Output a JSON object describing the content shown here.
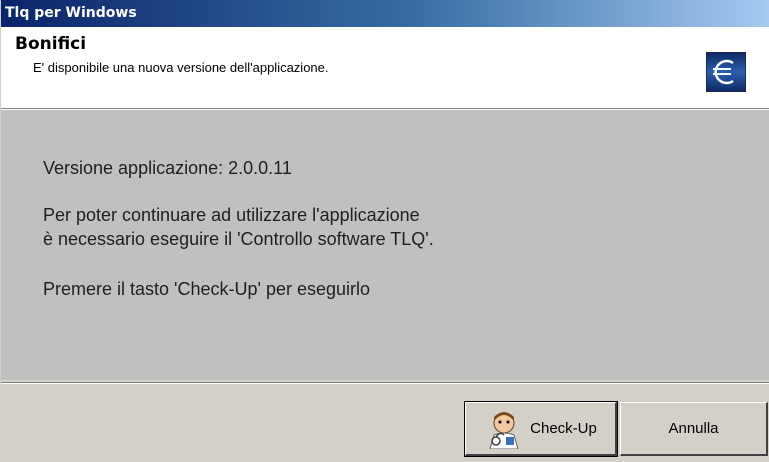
{
  "window": {
    "title": "Tlq per Windows"
  },
  "header": {
    "title": "Bonifici",
    "subtitle": "E' disponibile una nuova versione dell'applicazione.",
    "icon": "euro-icon"
  },
  "message": {
    "version_line": "Versione applicazione: 2.0.0.11",
    "line1": "Per poter continuare ad utilizzare l'applicazione",
    "line2": "è necessario eseguire il 'Controllo software TLQ'.",
    "line3": "Premere il tasto 'Check-Up' per eseguirlo"
  },
  "buttons": {
    "checkup_label": "Check-Up",
    "checkup_icon": "doctor-icon",
    "cancel_label": "Annulla"
  },
  "colors": {
    "titlebar_start": "#0a246a",
    "titlebar_end": "#a6caf0",
    "content_bg": "#c0c0c0",
    "face": "#d4d0c8"
  }
}
